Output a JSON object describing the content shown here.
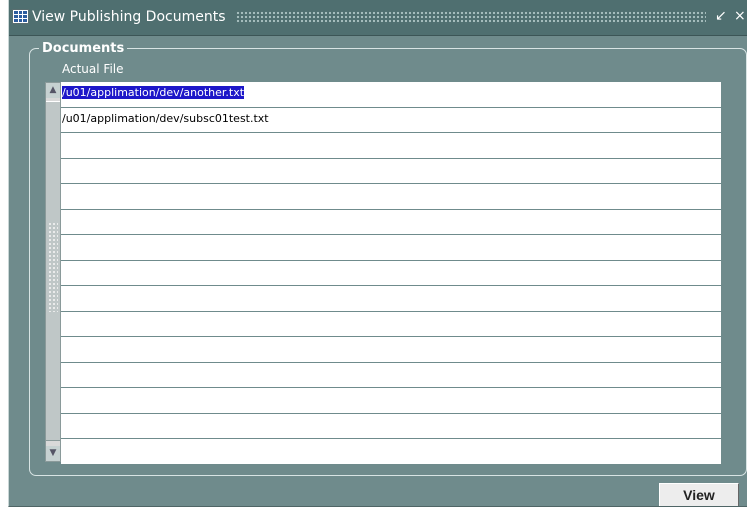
{
  "window": {
    "title": "View Publishing Documents",
    "icon": "grid-window-icon",
    "controls": {
      "minimize": "↙",
      "close": "×"
    }
  },
  "documents": {
    "legend": "Documents",
    "column_header": "Actual File",
    "rows": [
      "/u01/applimation/dev/another.txt",
      "/u01/applimation/dev/subsc01test.txt",
      "",
      "",
      "",
      "",
      "",
      "",
      "",
      "",
      "",
      "",
      "",
      "",
      ""
    ],
    "selected_row": 0
  },
  "buttons": {
    "view": "View"
  },
  "colors": {
    "background": "#6f8b8c",
    "selection": "#1d17c9"
  }
}
